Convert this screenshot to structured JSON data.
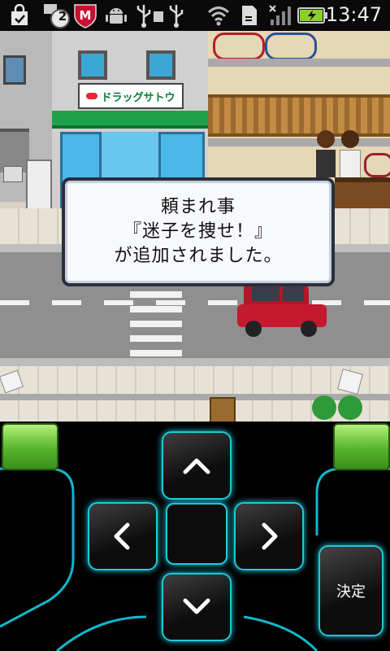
{
  "status_bar": {
    "time": "13:47",
    "notification_count": "2",
    "icons": [
      "shopping-bag-icon",
      "notification-badge-icon",
      "mcafee-icon",
      "android-debug-icon",
      "usb-icon",
      "usb-storage-icon",
      "usb-connected-icon",
      "wifi-icon",
      "sd-card-icon",
      "signal-icon",
      "battery-charging-icon"
    ]
  },
  "scene": {
    "shop_sign": "ドラッグサトウ"
  },
  "dialog": {
    "line1": "頼まれ事",
    "line2": "『迷子を捜せ！』",
    "line3": "が追加されました。"
  },
  "controller": {
    "decide_label": "決定",
    "buttons": [
      "up-arrow-icon",
      "down-arrow-icon",
      "left-arrow-icon",
      "right-arrow-icon"
    ]
  }
}
